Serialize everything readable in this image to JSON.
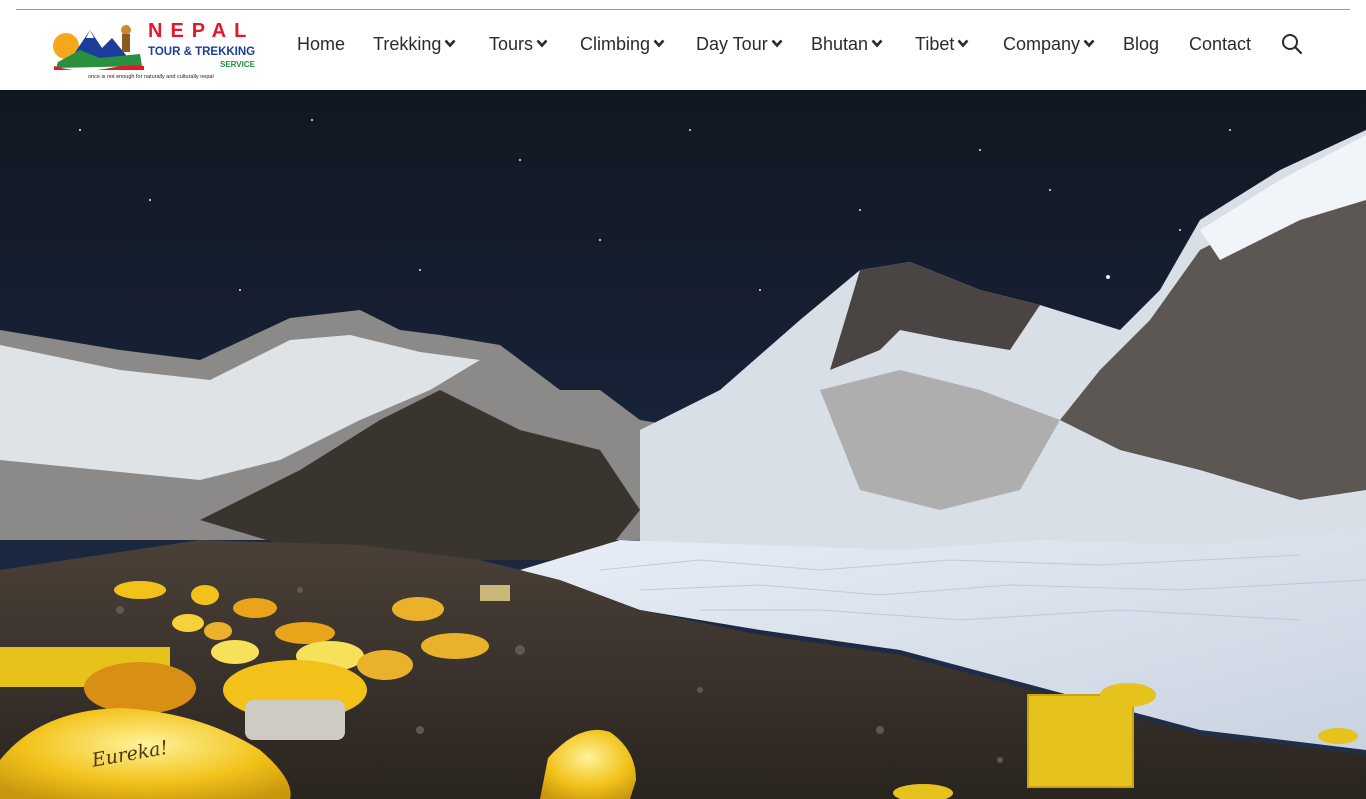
{
  "logo": {
    "brand": "NEPAL",
    "subtitle": "TOUR & TREKKING",
    "service": "SERVICE",
    "tagline": "once is not enough for naturally and culturally nepal"
  },
  "nav": {
    "items": [
      {
        "label": "Home",
        "dropdown": false
      },
      {
        "label": "Trekking",
        "dropdown": true
      },
      {
        "label": "Tours",
        "dropdown": true
      },
      {
        "label": "Climbing",
        "dropdown": true
      },
      {
        "label": "Day Tour",
        "dropdown": true
      },
      {
        "label": "Bhutan",
        "dropdown": true
      },
      {
        "label": "Tibet",
        "dropdown": true
      },
      {
        "label": "Company",
        "dropdown": true
      },
      {
        "label": "Blog",
        "dropdown": false
      },
      {
        "label": "Contact",
        "dropdown": false
      }
    ],
    "search_icon": "search-icon"
  },
  "hero": {
    "tent_text": "Eureka!"
  },
  "colors": {
    "logo_red": "#e4182c",
    "logo_blue": "#1a3e9a",
    "nav_text": "#2b2b2b",
    "sky": "#141c2c",
    "tent_yellow": "#f2c21a"
  }
}
